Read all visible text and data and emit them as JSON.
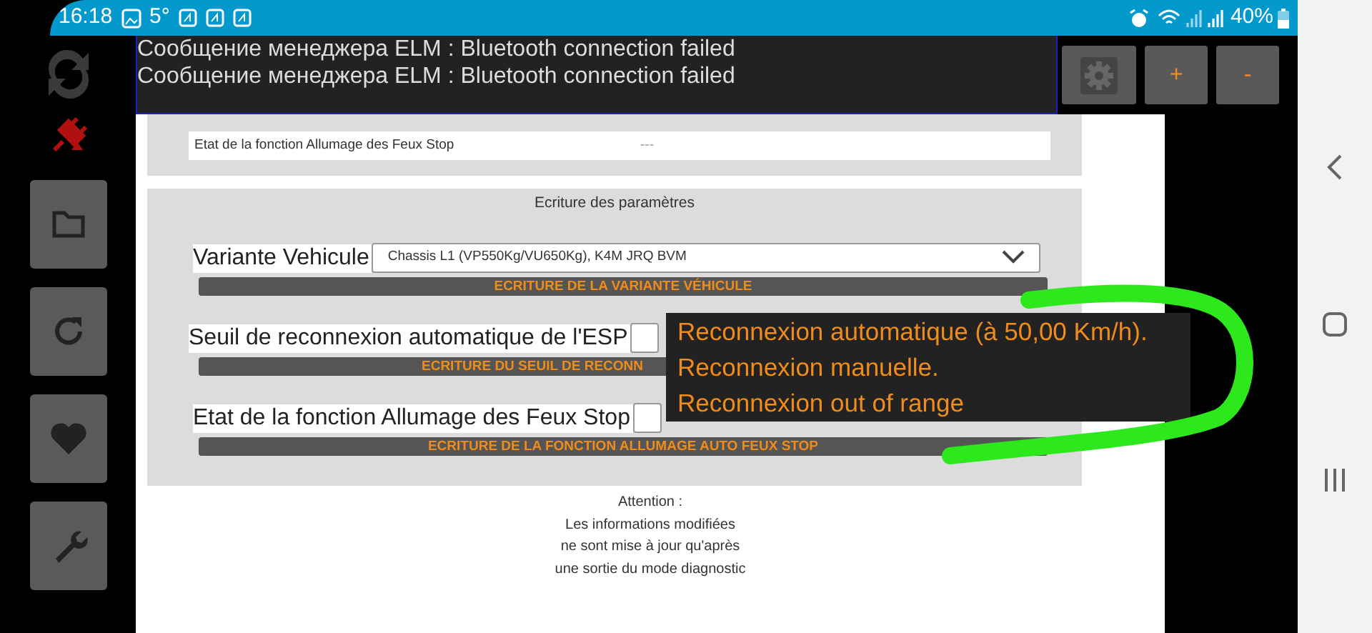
{
  "status_bar": {
    "time": "16:18",
    "temperature": "5°",
    "battery": "40%"
  },
  "messages": [
    "Сообщение менеджера ELM : Bluetooth connection failed",
    "Сообщение менеджера ELM : Bluetooth connection failed"
  ],
  "header_buttons": [
    {
      "kind": "settings",
      "disabled": true
    },
    {
      "kind": "text",
      "label": "+"
    },
    {
      "kind": "text",
      "label": "-"
    }
  ],
  "sidebar": [
    {
      "kind": "folder"
    },
    {
      "kind": "refresh"
    },
    {
      "kind": "heart"
    },
    {
      "kind": "wrench"
    }
  ],
  "status_row": {
    "label": "Etat de la fonction Allumage des Feux Stop",
    "value": "---"
  },
  "params": {
    "title": "Ecriture des paramètres",
    "rows": [
      {
        "label": "Variante Vehicule",
        "value": "Chassis L1 (VP550Kg/VU650Kg), K4M JRQ BVM",
        "button": "ECRITURE DE LA VARIANTE VÉHICULE"
      },
      {
        "label": "Seuil de reconnexion automatique de l'ESP",
        "button": "ECRITURE DU SEUIL DE RECONN"
      },
      {
        "label": "Etat de la fonction Allumage des Feux Stop",
        "button": "ECRITURE DE LA FONCTION ALLUMAGE AUTO FEUX STOP"
      }
    ]
  },
  "dropdown_options": [
    "Reconnexion automatique (à 50,00 Km/h).",
    "Reconnexion manuelle.",
    "Reconnexion out of range"
  ],
  "notice": [
    "Attention :",
    "Les informations modifiées",
    "ne sont mise à jour qu'après",
    "une sortie du mode diagnostic"
  ]
}
